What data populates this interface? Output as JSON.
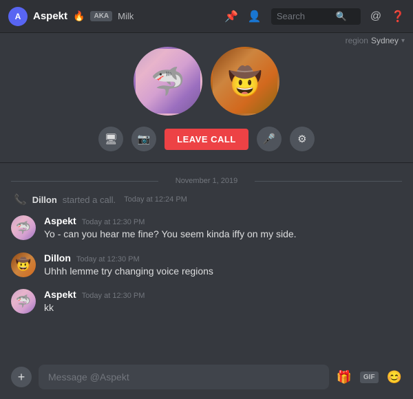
{
  "topbar": {
    "username": "Aspekt",
    "fire_emoji": "🔥",
    "aka_label": "AKA",
    "aka_name": "Milk",
    "search_placeholder": "Search",
    "region_label": "region",
    "region_value": "Sydney"
  },
  "call": {
    "avatar1_emoji": "🦈",
    "avatar2_emoji": "🤠",
    "leave_label": "LEAVE CALL",
    "screen_icon": "🖥",
    "camera_icon": "📷",
    "mic_icon": "🎤",
    "settings_icon": "⚙"
  },
  "chat": {
    "date_divider": "November 1, 2019",
    "system_msg": {
      "username": "Dillon",
      "action": "started a call.",
      "time": "Today at 12:24 PM"
    },
    "messages": [
      {
        "id": 1,
        "username": "Aspekt",
        "time": "Today at 12:30 PM",
        "text": "Yo - can you hear me fine? You seem kinda iffy on my side.",
        "avatar_type": "aspekt"
      },
      {
        "id": 2,
        "username": "Dillon",
        "time": "Today at 12:30 PM",
        "text": "Uhhh lemme try changing voice regions",
        "avatar_type": "dillon"
      },
      {
        "id": 3,
        "username": "Aspekt",
        "time": "Today at 12:30 PM",
        "text": "kk",
        "avatar_type": "aspekt"
      }
    ]
  },
  "input": {
    "placeholder": "Message @Aspekt",
    "add_icon": "+",
    "gift_label": "🎁",
    "gif_label": "GIF",
    "emoji_icon": "😊"
  }
}
